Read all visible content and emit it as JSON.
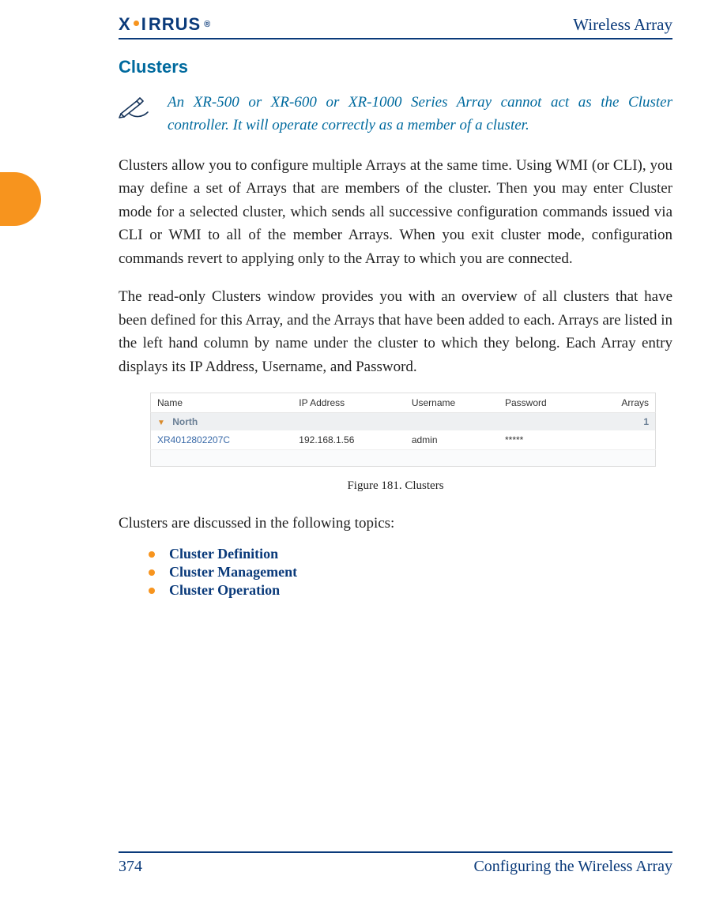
{
  "header": {
    "brand_text": "XIRRUS",
    "doc_title": "Wireless Array"
  },
  "section": {
    "heading": "Clusters",
    "note": "An XR-500 or XR-600 or XR-1000 Series Array cannot act as the Cluster controller. It will operate correctly as a member of a cluster.",
    "para1": "Clusters allow you to configure multiple Arrays at the same time. Using WMI (or CLI), you may define a set of Arrays that are members of the cluster. Then you may enter Cluster mode for a selected cluster, which sends all successive configuration commands issued via CLI or WMI to all of the member Arrays. When you exit cluster mode, configuration commands revert to applying only to the Array to which you are connected.",
    "para2": "The read-only Clusters window provides you with an overview of all clusters that have been defined for this Array, and the Arrays that have been added to each. Arrays are listed in the left hand column by name under the cluster to which they belong. Each Array entry displays its IP Address, Username, and Password.",
    "figure_caption": "Figure 181. Clusters",
    "topics_intro": "Clusters are discussed in the following topics:",
    "topics": [
      {
        "label": "Cluster Definition"
      },
      {
        "label": "Cluster Management"
      },
      {
        "label": "Cluster Operation"
      }
    ]
  },
  "figure_table": {
    "headers": [
      "Name",
      "IP Address",
      "Username",
      "Password",
      "Arrays"
    ],
    "group": {
      "name": "North",
      "arrays_count": "1"
    },
    "rows": [
      {
        "name": "XR4012802207C",
        "ip": "192.168.1.56",
        "user": "admin",
        "pass": "*****"
      }
    ]
  },
  "footer": {
    "page_number": "374",
    "section_title": "Configuring the Wireless Array"
  },
  "colors": {
    "brand_blue": "#0a3a7a",
    "accent_orange": "#f7941e",
    "teal_heading": "#006a9e"
  }
}
